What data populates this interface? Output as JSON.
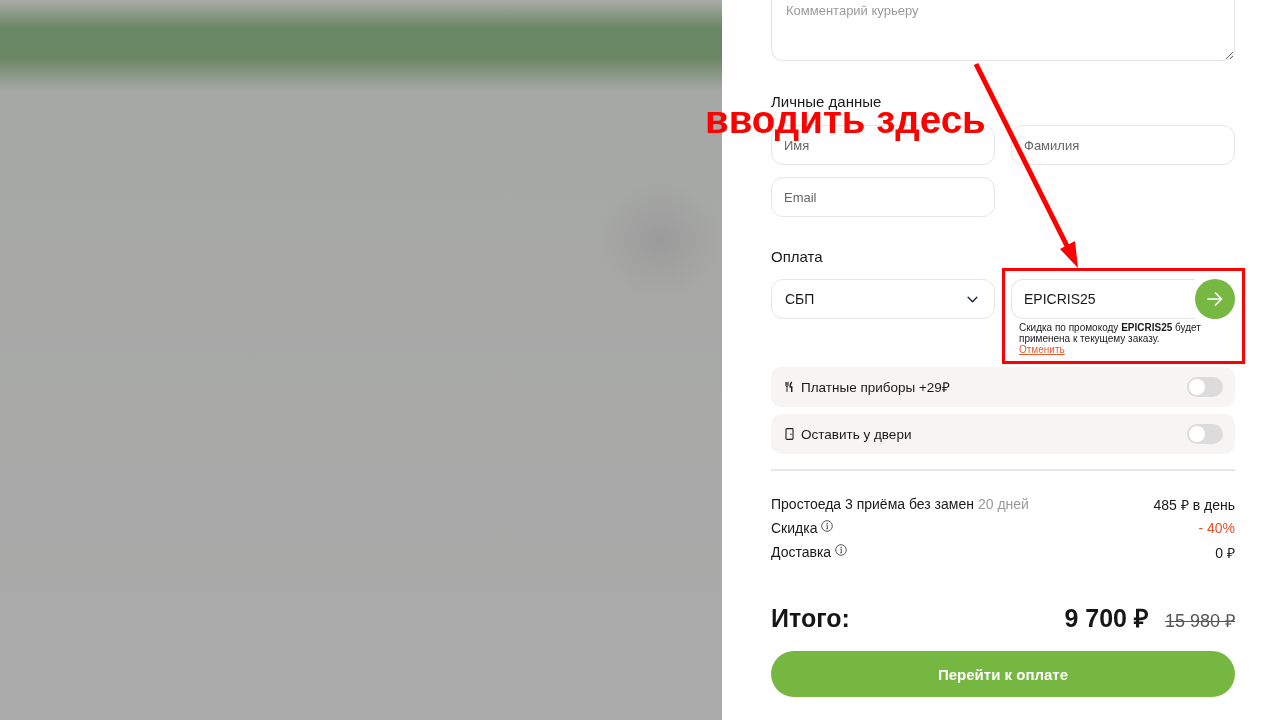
{
  "comment": {
    "placeholder": "Комментарий курьеру"
  },
  "personal": {
    "title": "Личные данные",
    "fields": [
      {
        "placeholder": "Имя"
      },
      {
        "placeholder": "Фамилия"
      },
      {
        "placeholder": "Email"
      }
    ]
  },
  "payment": {
    "title": "Оплата",
    "method": {
      "value": "СБП"
    },
    "promo": {
      "value": "EPICRIS25",
      "message": "Скидка по промокоду **EPICRIS25** будет применена к текущему заказу.",
      "cancel": "Отменить"
    }
  },
  "options": [
    {
      "kind": "cutlery",
      "label": "Платные приборы +29₽",
      "on": false
    },
    {
      "kind": "door",
      "label": "Оставить у двери",
      "on": false
    }
  ],
  "summary": [
    {
      "kind": "amount",
      "label": "Простоеда 3 приёма без замен",
      "note": "20 дней",
      "info": false,
      "value": "485 ₽ в день"
    },
    {
      "kind": "discount",
      "label": "Скидка",
      "info": true,
      "value": "- 40%"
    },
    {
      "kind": "amount",
      "label": "Доставка",
      "info": true,
      "value": "0 ₽"
    }
  ],
  "total": {
    "label": "Итого:",
    "price": "9 700 ₽",
    "old_price": "15 980 ₽"
  },
  "checkout_button": "Перейти к оплате",
  "annotation": {
    "text": "вводить здесь"
  }
}
